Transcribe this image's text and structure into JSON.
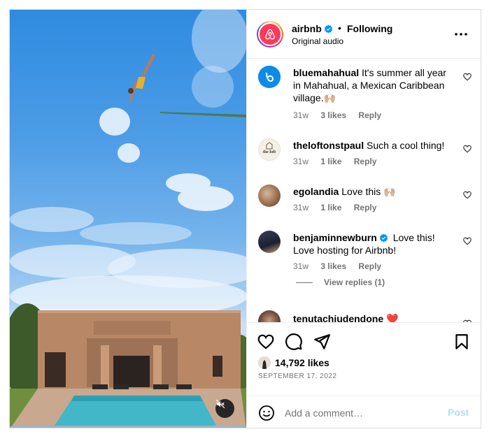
{
  "header": {
    "username": "airbnb",
    "separator": "•",
    "follow_status": "Following",
    "audio": "Original audio"
  },
  "comments": [
    {
      "user": "bluemahahual",
      "text": "It's summer all year in Mahahual, a Mexican Caribbean village.🙌🏼",
      "age": "31w",
      "likes": "3 likes",
      "reply": "Reply"
    },
    {
      "user": "theloftonstpaul",
      "text": "Such a cool thing!",
      "age": "31w",
      "likes": "1 like",
      "reply": "Reply"
    },
    {
      "user": "egolandia",
      "text": "Love this 🙌🏼",
      "age": "31w",
      "likes": "1 like",
      "reply": "Reply"
    },
    {
      "user": "benjaminnewburn",
      "text": "Love this! Love hosting for Airbnb!",
      "age": "31w",
      "likes": "3 likes",
      "reply": "Reply"
    },
    {
      "user": "tenutachiudendone",
      "text": "❤️"
    }
  ],
  "view_replies": "View replies (1)",
  "avatar_labels": {
    "loft": "the loft"
  },
  "likes": "14,792 likes",
  "date": "SEPTEMBER 17, 2022",
  "add_comment": {
    "placeholder": "Add a comment…",
    "post_label": "Post"
  },
  "colors": {
    "airbnb_brand": "#ff385c",
    "verified": "#0095f6",
    "post_disabled": "#b2dffc",
    "meta_gray": "#737373"
  }
}
